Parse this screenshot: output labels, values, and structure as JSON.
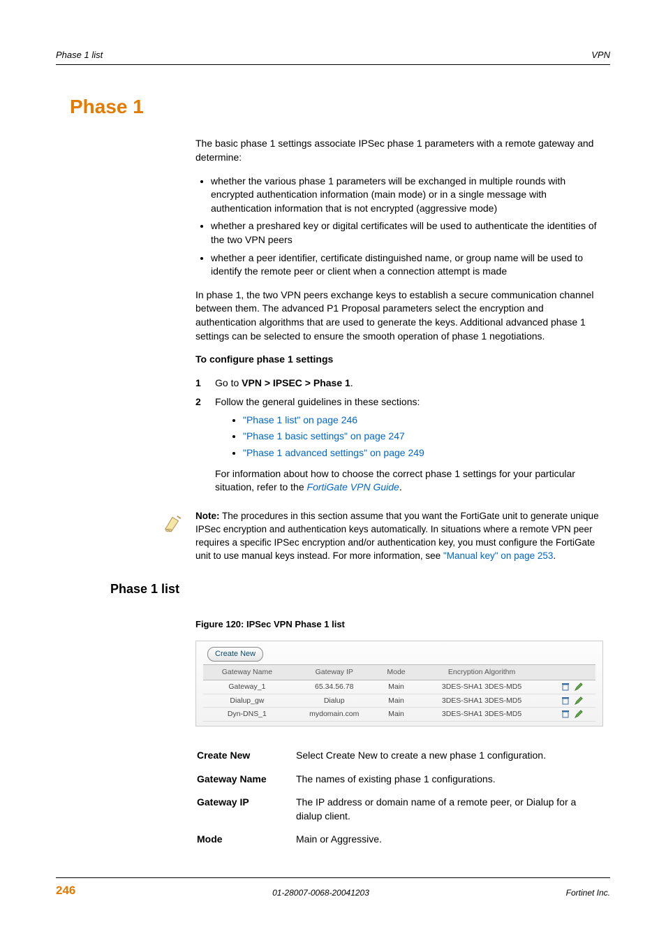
{
  "header": {
    "left": "Phase 1 list",
    "right": "VPN"
  },
  "title": "Phase 1",
  "intro": "The basic phase 1 settings associate IPSec phase 1 parameters with a remote gateway and determine:",
  "intro_bullets": [
    "whether the various phase 1 parameters will be exchanged in multiple rounds with encrypted authentication information (main mode) or in a single message with authentication information that is not encrypted (aggressive mode)",
    "whether a preshared key or digital certificates will be used to authenticate the identities of the two VPN peers",
    "whether a peer identifier, certificate distinguished name, or group name will be used to identify the remote peer or client when a connection attempt is made"
  ],
  "para2": "In phase 1, the two VPN peers exchange keys to establish a secure communication channel between them. The advanced P1 Proposal parameters select the encryption and authentication algorithms that are used to generate the keys. Additional advanced phase 1 settings can be selected to ensure the smooth operation of phase 1 negotiations.",
  "configure_heading": "To configure phase 1 settings",
  "step1_pre": "Go to ",
  "step1_bold": "VPN > IPSEC > Phase 1",
  "step1_post": ".",
  "step2_text": "Follow the general guidelines in these sections:",
  "step2_links": [
    "\"Phase 1 list\" on page 246",
    "\"Phase 1 basic settings\" on page 247",
    "\"Phase 1 advanced settings\" on page 249"
  ],
  "step2_after_pre": "For information about how to choose the correct phase 1 settings for your particular situation, refer to the ",
  "step2_after_link": "FortiGate VPN Guide",
  "step2_after_post": ".",
  "note_label": "Note:",
  "note_body_1": " The procedures in this section assume that you want the FortiGate unit to generate unique IPSec encryption and authentication keys automatically. In situations where a remote VPN peer requires a specific IPSec encryption and/or authentication key, you must configure the FortiGate unit to use manual keys instead. For more information, see ",
  "note_link": "\"Manual key\" on page 253",
  "note_body_2": ".",
  "section_heading": "Phase 1 list",
  "figure_caption": "Figure 120: IPSec VPN Phase 1 list",
  "screenshot": {
    "create_label": "Create New",
    "columns": [
      "Gateway Name",
      "Gateway IP",
      "Mode",
      "Encryption Algorithm",
      ""
    ],
    "rows": [
      {
        "name": "Gateway_1",
        "ip": "65.34.56.78",
        "mode": "Main",
        "alg": "3DES-SHA1 3DES-MD5"
      },
      {
        "name": "Dialup_gw",
        "ip": "Dialup",
        "mode": "Main",
        "alg": "3DES-SHA1 3DES-MD5"
      },
      {
        "name": "Dyn-DNS_1",
        "ip": "mydomain.com",
        "mode": "Main",
        "alg": "3DES-SHA1 3DES-MD5"
      }
    ]
  },
  "descriptions": [
    {
      "label": "Create New",
      "text": "Select Create New to create a new phase 1 configuration."
    },
    {
      "label": "Gateway Name",
      "text": "The names of existing phase 1 configurations."
    },
    {
      "label": "Gateway IP",
      "text": "The IP address or domain name of a remote peer, or Dialup for a dialup client."
    },
    {
      "label": "Mode",
      "text": "Main or Aggressive."
    }
  ],
  "footer": {
    "page": "246",
    "docid": "01-28007-0068-20041203",
    "company": "Fortinet Inc."
  }
}
